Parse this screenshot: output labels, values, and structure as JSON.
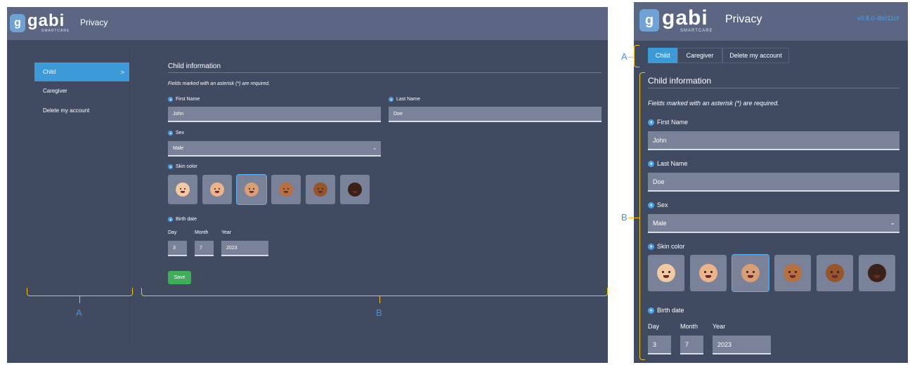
{
  "app": {
    "logo": "gabi",
    "logo_sub": "SMARTCARE",
    "page_title": "Privacy",
    "version": "v0.8.0-4b011cf"
  },
  "nav": {
    "items": [
      {
        "label": "Child",
        "chevron": ">"
      },
      {
        "label": "Caregiver"
      },
      {
        "label": "Delete my account"
      }
    ]
  },
  "form": {
    "section_title": "Child information",
    "required_note": "Fields marked with an asterisk (*) are required.",
    "first_name": {
      "label": "First Name",
      "value": "John"
    },
    "last_name": {
      "label": "Last Name",
      "value": "Doe"
    },
    "sex": {
      "label": "Sex",
      "value": "Male"
    },
    "skin_color": {
      "label": "Skin color",
      "selected_index": 2
    },
    "birth_date": {
      "label": "Birth date",
      "day_label": "Day",
      "month_label": "Month",
      "year_label": "Year",
      "day": "3",
      "month": "7",
      "year": "2023"
    },
    "save_label": "Save"
  },
  "annotations": {
    "a": "A",
    "b": "B"
  },
  "colors": {
    "background": "#404a61",
    "topbar": "#5b6683",
    "accent": "#3d9ad8",
    "field": "#7a8299",
    "save": "#3fae5a",
    "bracket": "#f5c400",
    "annotation": "#4a90d9"
  },
  "skin_tones": [
    "#f2c9a3",
    "#ebb48a",
    "#d99e74",
    "#b8703f",
    "#99552a",
    "#3b2218"
  ]
}
